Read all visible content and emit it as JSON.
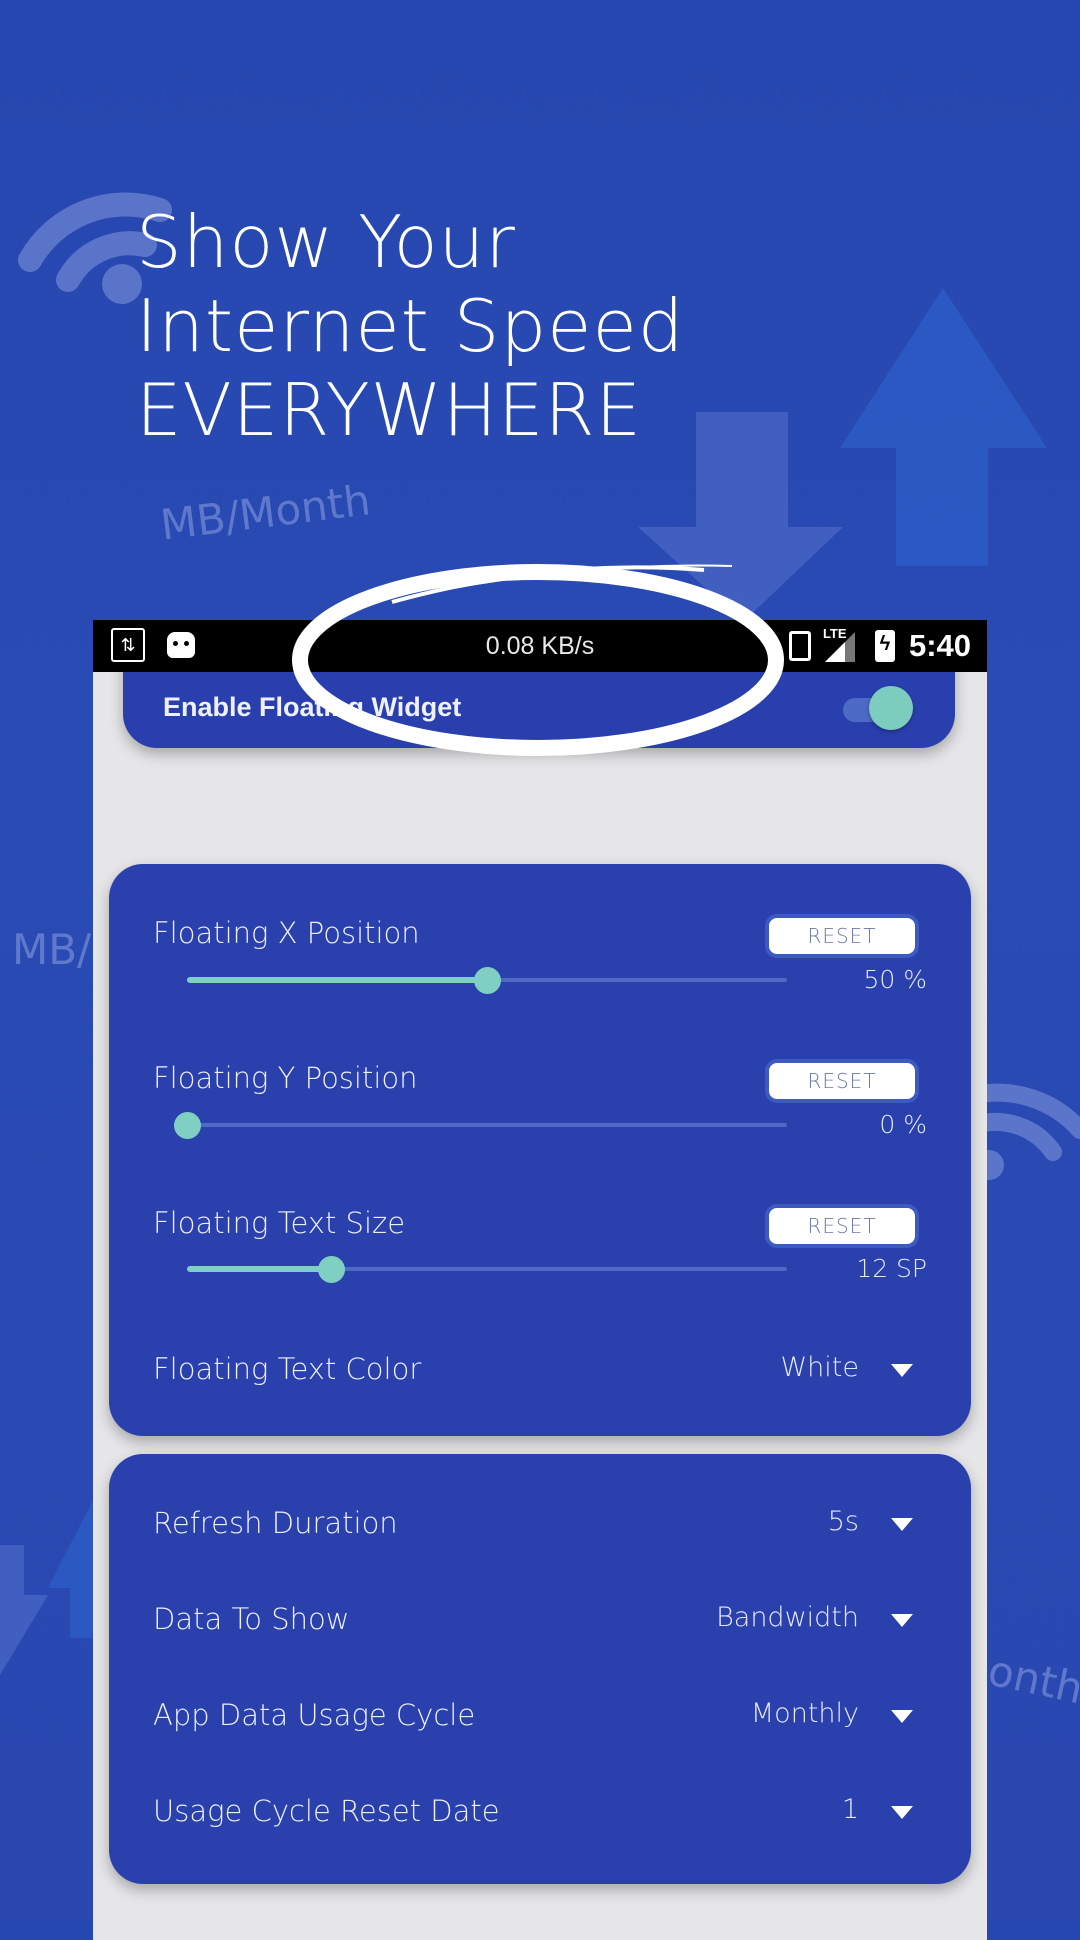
{
  "promo": {
    "headline_lines": [
      "Show Your",
      "Internet Speed",
      "EVERYWHERE"
    ],
    "decor_texts": [
      "MB/Month",
      "MB/",
      "onth"
    ]
  },
  "status_bar": {
    "speed": "0.08 KB/s",
    "network": "LTE",
    "time": "5:40",
    "battery_glyph": "ϟ"
  },
  "widget_card": {
    "enable_label": "Enable Floating Widget",
    "enabled": true
  },
  "position_card": {
    "reset_label": "RESET",
    "sliders": [
      {
        "label": "Floating X Position",
        "value_text": "50 %",
        "fraction": 0.5
      },
      {
        "label": "Floating Y Position",
        "value_text": "0 %",
        "fraction": 0.0
      },
      {
        "label": "Floating Text Size",
        "value_text": "12 SP",
        "fraction": 0.24
      }
    ],
    "text_color": {
      "label": "Floating Text Color",
      "value": "White"
    }
  },
  "settings_card": {
    "dropdowns": [
      {
        "label": "Refresh Duration",
        "value": "5s"
      },
      {
        "label": "Data To Show",
        "value": "Bandwidth"
      },
      {
        "label": "App Data Usage Cycle",
        "value": "Monthly"
      },
      {
        "label": "Usage Cycle Reset Date",
        "value": "1"
      }
    ]
  },
  "colors": {
    "background": "#2a48b0",
    "card": "#2a40ad",
    "accent": "#7fcfc2",
    "phone_bg": "#e6e6e8"
  }
}
